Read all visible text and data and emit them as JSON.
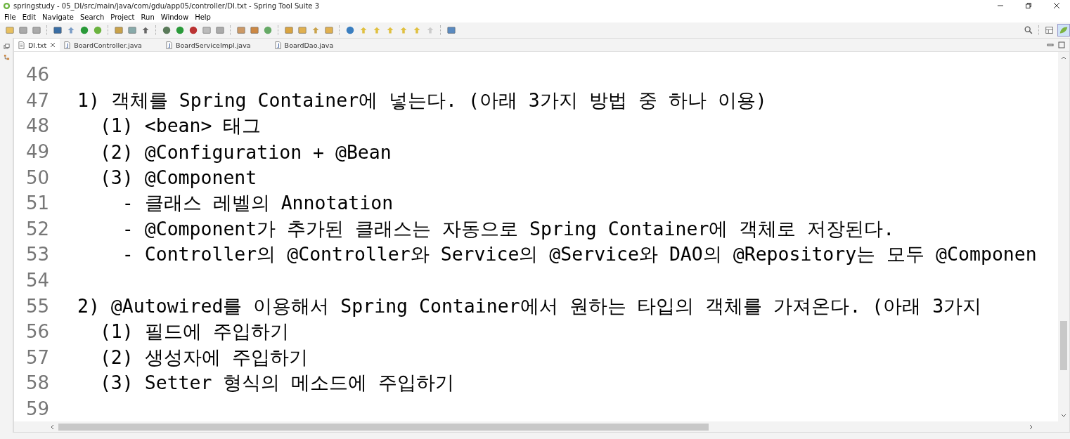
{
  "window": {
    "title": "springstudy - 05_DI/src/main/java/com/gdu/app05/controller/DI.txt - Spring Tool Suite 3"
  },
  "menu": [
    "File",
    "Edit",
    "Navigate",
    "Search",
    "Project",
    "Run",
    "Window",
    "Help"
  ],
  "tabs": [
    {
      "label": "DI.txt",
      "kind": "text",
      "selected": true
    },
    {
      "label": "BoardController.java",
      "kind": "java",
      "selected": false
    },
    {
      "label": "BoardServiceImpl.java",
      "kind": "java",
      "selected": false
    },
    {
      "label": "BoardDao.java",
      "kind": "java",
      "selected": false
    }
  ],
  "editor": {
    "lines": [
      {
        "number": "46"
      },
      {
        "number": "47",
        "text": "1) 객체를 Spring Container에 넣는다. (아래 3가지 방법 중 하나 이용)"
      },
      {
        "number": "48",
        "text": "  (1) <bean> 태그"
      },
      {
        "number": "49",
        "text": "  (2) @Configuration + @Bean"
      },
      {
        "number": "50",
        "text": "  (3) @Component"
      },
      {
        "number": "51",
        "text": "    - 클래스 레벨의 Annotation"
      },
      {
        "number": "52",
        "text": "    - @Component가 추가된 클래스는 자동으로 Spring Container에 객체로 저장된다."
      },
      {
        "number": "53",
        "text": "    - Controller의 @Controller와 Service의 @Service와 DAO의 @Repository는 모두 @Componen"
      },
      {
        "number": "54"
      },
      {
        "number": "55",
        "text": "2) @Autowired를 이용해서 Spring Container에서 원하는 타입의 객체를 가져온다. (아래 3가지"
      },
      {
        "number": "56",
        "text": "  (1) 필드에 주입하기"
      },
      {
        "number": "57",
        "text": "  (2) 생성자에 주입하기"
      },
      {
        "number": "58",
        "text": "  (3) Setter 형식의 메소드에 주입하기"
      },
      {
        "number": "59"
      }
    ]
  }
}
